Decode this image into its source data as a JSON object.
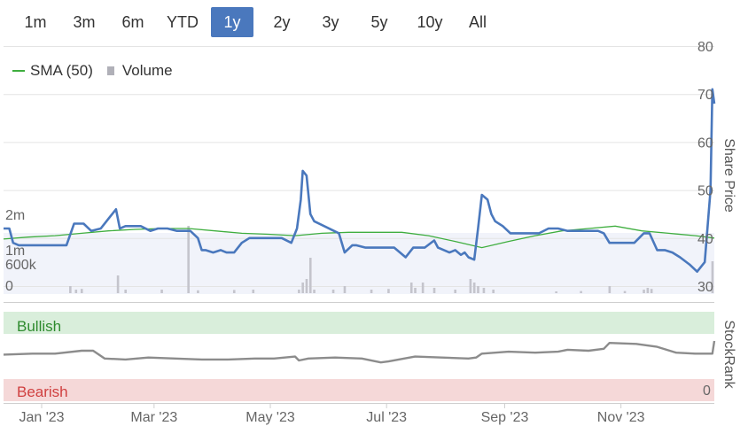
{
  "range_selector": {
    "buttons": [
      "1m",
      "3m",
      "6m",
      "YTD",
      "1y",
      "2y",
      "3y",
      "5y",
      "10y",
      "All"
    ],
    "active": "1y"
  },
  "legend": {
    "sma_label": "SMA (50)",
    "volume_label": "Volume"
  },
  "colors": {
    "price": "#4a78bd",
    "sma": "#3fae3f",
    "volume": "#c4c4cc",
    "stockrank": "#8c8c8c",
    "bullish_bg": "#d9eedb",
    "bullish_text": "#2e8b2e",
    "bearish_bg": "#f5d8d8",
    "bearish_text": "#d04040"
  },
  "chart_data": [
    {
      "type": "line",
      "panel": "price",
      "ylabel": "Share Price",
      "ylim": [
        30,
        80
      ],
      "yticks": [
        "30",
        "40",
        "50",
        "60",
        "70",
        "80"
      ],
      "volume_ticks": [
        "0",
        "600k",
        "1m",
        "2m"
      ],
      "xlim": [
        "2022-12-12",
        "2023-12-20"
      ],
      "xticks": [
        {
          "date": "2023-01-01",
          "label": "Jan '23"
        },
        {
          "date": "2023-03-01",
          "label": "Mar '23"
        },
        {
          "date": "2023-05-01",
          "label": "May '23"
        },
        {
          "date": "2023-07-01",
          "label": "Jul '23"
        },
        {
          "date": "2023-09-01",
          "label": "Sep '23"
        },
        {
          "date": "2023-11-01",
          "label": "Nov '23"
        }
      ],
      "series": [
        {
          "name": "Share Price",
          "x": [
            "2022-12-12",
            "2022-12-15",
            "2022-12-17",
            "2022-12-20",
            "2022-12-27",
            "2023-01-03",
            "2023-01-08",
            "2023-01-14",
            "2023-01-18",
            "2023-01-23",
            "2023-01-27",
            "2023-02-01",
            "2023-02-05",
            "2023-02-09",
            "2023-02-11",
            "2023-02-14",
            "2023-02-18",
            "2023-02-22",
            "2023-02-27",
            "2023-03-03",
            "2023-03-08",
            "2023-03-13",
            "2023-03-20",
            "2023-03-24",
            "2023-03-26",
            "2023-03-28",
            "2023-04-01",
            "2023-04-05",
            "2023-04-08",
            "2023-04-12",
            "2023-04-16",
            "2023-04-20",
            "2023-04-25",
            "2023-04-29",
            "2023-05-02",
            "2023-05-07",
            "2023-05-12",
            "2023-05-15",
            "2023-05-17",
            "2023-05-18",
            "2023-05-20",
            "2023-05-22",
            "2023-05-24",
            "2023-06-06",
            "2023-06-09",
            "2023-06-13",
            "2023-06-15",
            "2023-06-20",
            "2023-06-28",
            "2023-07-05",
            "2023-07-11",
            "2023-07-15",
            "2023-07-21",
            "2023-07-26",
            "2023-07-28",
            "2023-08-03",
            "2023-08-06",
            "2023-08-09",
            "2023-08-11",
            "2023-08-13",
            "2023-08-16",
            "2023-08-18",
            "2023-08-20",
            "2023-08-23",
            "2023-08-25",
            "2023-08-27",
            "2023-08-31",
            "2023-09-04",
            "2023-09-10",
            "2023-09-19",
            "2023-09-24",
            "2023-09-29",
            "2023-10-04",
            "2023-10-10",
            "2023-10-20",
            "2023-10-23",
            "2023-10-26",
            "2023-10-31",
            "2023-11-04",
            "2023-11-08",
            "2023-11-13",
            "2023-11-16",
            "2023-11-20",
            "2023-11-24",
            "2023-11-28",
            "2023-12-02",
            "2023-12-07",
            "2023-12-11",
            "2023-12-15",
            "2023-12-18",
            "2023-12-19",
            "2023-12-20"
          ],
          "values": [
            42,
            42,
            39,
            38.5,
            38.5,
            38.5,
            38.5,
            38.5,
            43,
            43,
            41.5,
            42,
            44,
            46,
            42,
            42.5,
            42.5,
            42.5,
            41.5,
            42,
            42,
            41.5,
            41.5,
            40,
            37.5,
            37.5,
            37,
            37.5,
            37,
            37,
            39,
            40,
            40,
            40,
            40,
            40,
            39,
            42,
            48,
            54,
            53,
            45,
            43.5,
            41,
            37,
            38.5,
            38.5,
            38,
            38,
            38,
            36,
            38,
            38,
            39.5,
            38,
            37,
            37.5,
            36.5,
            37,
            36,
            35.5,
            42,
            49,
            48,
            45,
            43.5,
            42.5,
            41,
            41,
            41,
            42,
            42,
            41.5,
            41.5,
            41.5,
            41,
            39,
            39,
            39,
            39,
            41,
            41,
            37.5,
            37.5,
            37,
            36,
            34.5,
            33,
            35,
            50,
            71,
            68
          ]
        },
        {
          "name": "SMA (50)",
          "x": [
            "2022-12-12",
            "2022-12-25",
            "2023-01-08",
            "2023-01-22",
            "2023-02-05",
            "2023-02-19",
            "2023-03-05",
            "2023-03-19",
            "2023-04-02",
            "2023-04-16",
            "2023-04-30",
            "2023-05-14",
            "2023-05-28",
            "2023-06-11",
            "2023-06-25",
            "2023-07-09",
            "2023-07-23",
            "2023-08-06",
            "2023-08-20",
            "2023-09-03",
            "2023-09-17",
            "2023-10-01",
            "2023-10-15",
            "2023-10-29",
            "2023-11-12",
            "2023-11-26",
            "2023-12-10",
            "2023-12-20"
          ],
          "values": [
            39.8,
            40.2,
            40.5,
            41,
            41.5,
            41.8,
            42,
            42,
            41.5,
            41,
            40.8,
            40.5,
            41,
            41.2,
            41.2,
            41.2,
            40.5,
            39.3,
            38,
            39.3,
            40.5,
            41.5,
            42,
            42.5,
            41.5,
            41,
            40.5,
            40
          ]
        }
      ],
      "volume": {
        "dates": [
          "2023-01-16",
          "2023-01-19",
          "2023-01-22",
          "2023-02-10",
          "2023-02-14",
          "2023-03-05",
          "2023-03-19",
          "2023-03-24",
          "2023-04-12",
          "2023-04-22",
          "2023-05-16",
          "2023-05-18",
          "2023-05-20",
          "2023-05-22",
          "2023-05-24",
          "2023-06-03",
          "2023-06-09",
          "2023-06-23",
          "2023-07-02",
          "2023-07-14",
          "2023-07-16",
          "2023-07-20",
          "2023-07-26",
          "2023-08-06",
          "2023-08-14",
          "2023-08-16",
          "2023-08-18",
          "2023-08-21",
          "2023-08-26",
          "2023-09-28",
          "2023-10-11",
          "2023-10-26",
          "2023-11-03",
          "2023-11-13",
          "2023-11-15",
          "2023-11-17",
          "2023-12-19"
        ],
        "values": [
          200000,
          100000,
          120000,
          500000,
          100000,
          100000,
          1900000,
          80000,
          90000,
          100000,
          100000,
          300000,
          400000,
          1000000,
          100000,
          100000,
          200000,
          100000,
          120000,
          300000,
          150000,
          300000,
          150000,
          100000,
          400000,
          300000,
          200000,
          150000,
          100000,
          50000,
          60000,
          200000,
          60000,
          100000,
          150000,
          120000,
          900000
        ]
      }
    },
    {
      "type": "line",
      "panel": "stockrank",
      "ylabel": "StockRank",
      "yticks": [
        "0"
      ],
      "bands": [
        "Bullish",
        "Bearish"
      ],
      "series": [
        {
          "name": "StockRank",
          "x": [
            "2022-12-12",
            "2022-12-27",
            "2023-01-08",
            "2023-01-22",
            "2023-01-28",
            "2023-02-03",
            "2023-02-14",
            "2023-02-26",
            "2023-03-12",
            "2023-03-26",
            "2023-04-09",
            "2023-04-23",
            "2023-05-03",
            "2023-05-14",
            "2023-05-16",
            "2023-05-21",
            "2023-06-04",
            "2023-06-18",
            "2023-06-28",
            "2023-07-02",
            "2023-07-16",
            "2023-07-30",
            "2023-08-13",
            "2023-08-17",
            "2023-08-20",
            "2023-09-03",
            "2023-09-17",
            "2023-09-29",
            "2023-10-04",
            "2023-10-15",
            "2023-10-23",
            "2023-10-26",
            "2023-11-09",
            "2023-11-20",
            "2023-11-30",
            "2023-12-10",
            "2023-12-19",
            "2023-12-20"
          ],
          "values": [
            36,
            37,
            37,
            40,
            40,
            32,
            31,
            33,
            32,
            31,
            31,
            32,
            32,
            34,
            30,
            32,
            33,
            32,
            28,
            29,
            34,
            33,
            32,
            33,
            37,
            39,
            38,
            39,
            41,
            40,
            42,
            48,
            47,
            44,
            38,
            37,
            37,
            50
          ]
        }
      ]
    }
  ]
}
